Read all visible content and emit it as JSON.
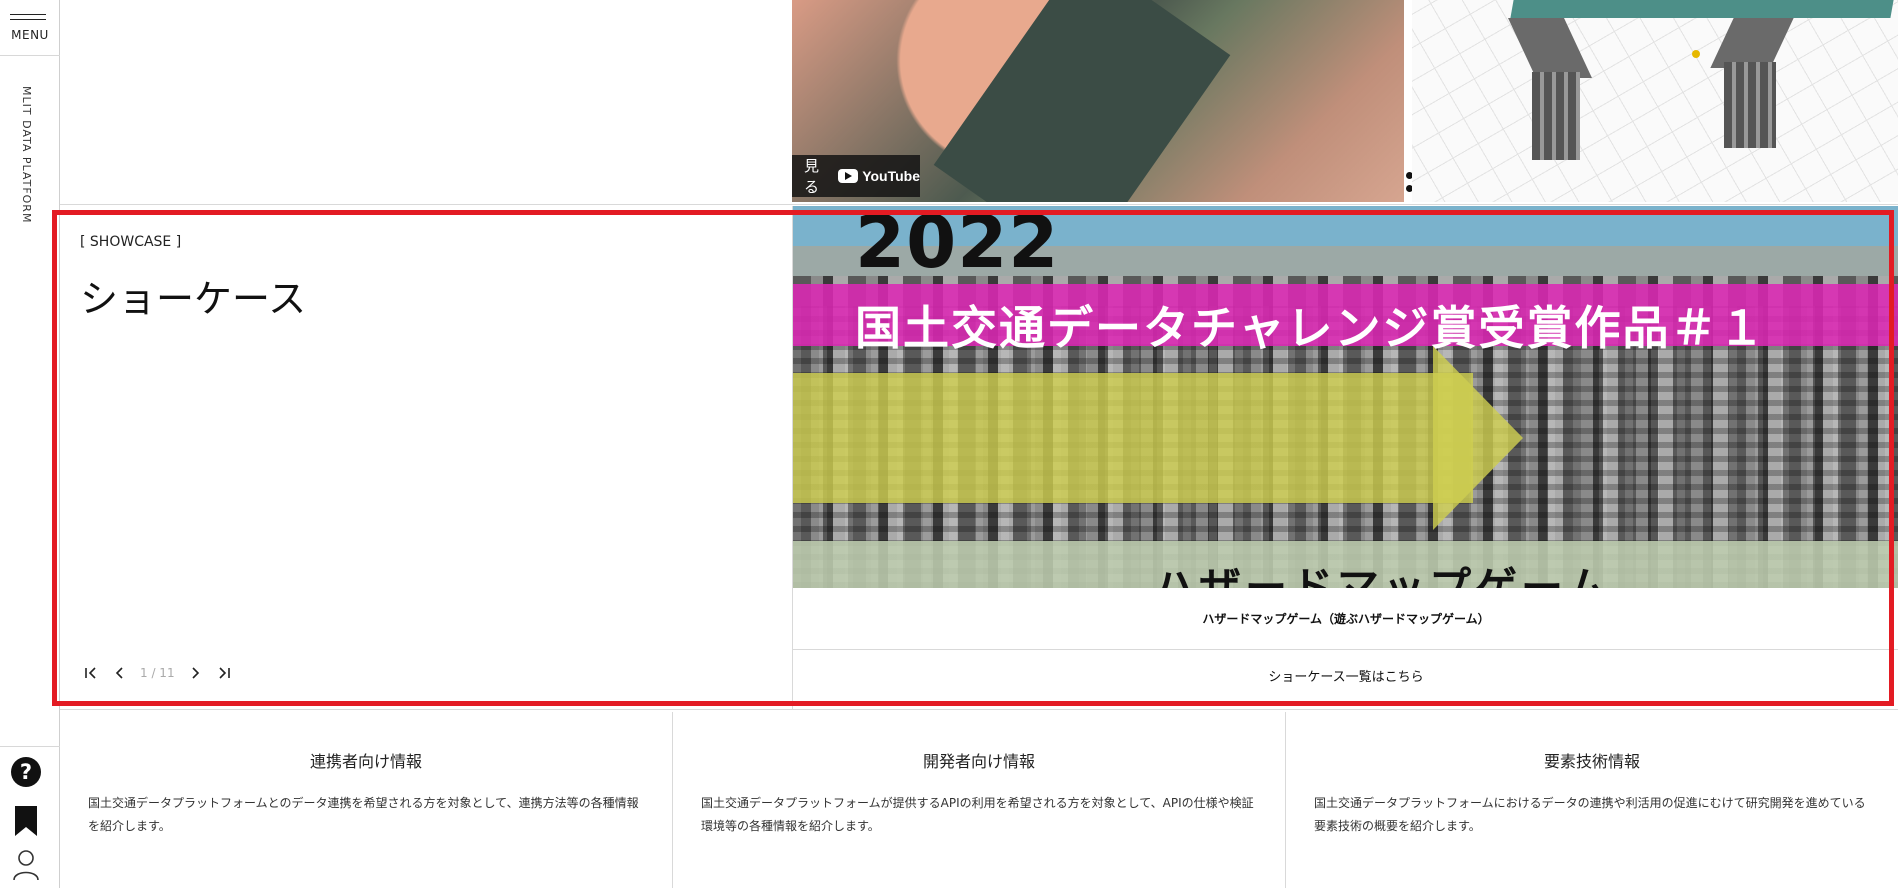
{
  "rail": {
    "menu_label": "MENU",
    "platform_name": "MLIT DATA PLATFORM"
  },
  "top": {
    "youtube_watch": "見る",
    "youtube_logo": "YouTube"
  },
  "showcase": {
    "tag": "[ SHOWCASE ]",
    "title": "ショーケース",
    "pager": {
      "current": "1",
      "total": "11",
      "label": "1 / 11"
    },
    "image": {
      "year": "2022",
      "banner": "国土交通データチャレンジ賞受賞作品＃１",
      "subtitle_partial": "ハザードマップゲーム"
    },
    "caption": "ハザードマップゲーム（遊ぶハザードマップゲーム）",
    "list_link": "ショーケース一覧はこちら"
  },
  "info": [
    {
      "title": "連携者向け情報",
      "desc": "国土交通データプラットフォームとのデータ連携を希望される方を対象として、連携方法等の各種情報を紹介します。"
    },
    {
      "title": "開発者向け情報",
      "desc": "国土交通データプラットフォームが提供するAPIの利用を希望される方を対象として、APIの仕様や検証環境等の各種情報を紹介します。"
    },
    {
      "title": "要素技術情報",
      "desc": "国土交通データプラットフォームにおけるデータの連携や利活用の促進にむけて研究開発を進めている要素技術の概要を紹介します。"
    }
  ],
  "colors": {
    "highlight": "#e31b23",
    "banner_pink": "#dc28b4",
    "band_yellow": "#cece50"
  }
}
